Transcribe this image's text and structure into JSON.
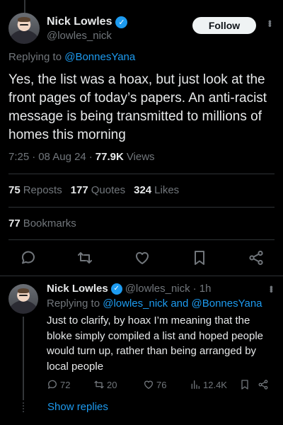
{
  "main_tweet": {
    "author_name": "Nick Lowles",
    "author_handle": "@lowles_nick",
    "follow_label": "Follow",
    "replying_prefix": "Replying to",
    "replying_to": "@BonnesYana",
    "text": "Yes, the list was a hoax, but just look at the front pages of today’s papers. An anti-racist message is being transmitted to millions of homes this morning",
    "time": "7:25",
    "date": "08 Aug 24",
    "views_count": "77.9K",
    "views_label": "Views",
    "sep": "·",
    "reposts_count": "75",
    "reposts_label": "Reposts",
    "quotes_count": "177",
    "quotes_label": "Quotes",
    "likes_count": "324",
    "likes_label": "Likes",
    "bookmarks_count": "77",
    "bookmarks_label": "Bookmarks"
  },
  "reply_tweet": {
    "author_name": "Nick Lowles",
    "author_handle": "@lowles_nick",
    "age": "· 1h",
    "replying_prefix": "Replying to",
    "replying_to": "@lowles_nick and @BonnesYana",
    "text": "Just to clarify, by hoax I’m meaning that the bloke simply compiled a list and hoped people would turn up, rather than being arranged by local people",
    "replies": "72",
    "reposts": "20",
    "likes": "76",
    "views": "12.4K"
  },
  "show_replies_label": "Show replies",
  "colors": {
    "background": "#000000",
    "text": "#e7e9ea",
    "muted": "#71767b",
    "accent": "#1d9bf0",
    "divider": "#2f3336"
  },
  "icons": [
    "verified-badge-icon",
    "more-icon",
    "reply-icon",
    "repost-icon",
    "like-icon",
    "bookmark-icon",
    "share-icon",
    "views-icon"
  ]
}
